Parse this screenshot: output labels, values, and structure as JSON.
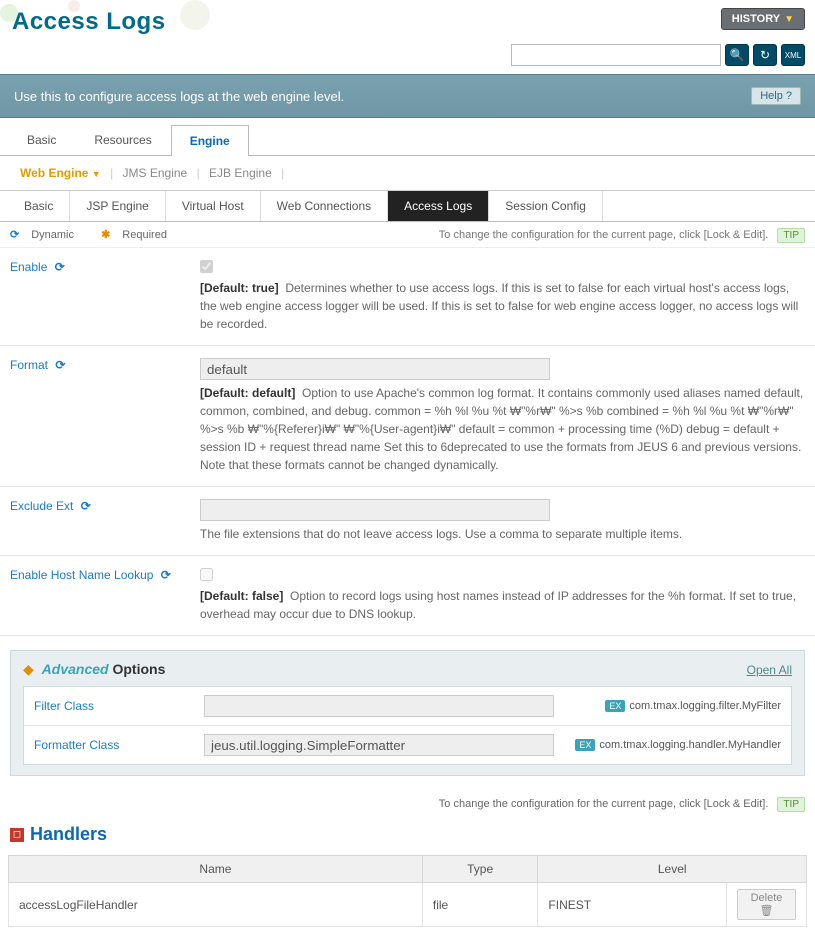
{
  "header": {
    "title": "Access Logs",
    "history_label": "HISTORY"
  },
  "search": {
    "placeholder": ""
  },
  "banner": {
    "text": "Use this to configure access logs at the web engine level.",
    "help_label": "Help ?"
  },
  "tabs1": {
    "basic": "Basic",
    "resources": "Resources",
    "engine": "Engine"
  },
  "subnav": {
    "web": "Web Engine",
    "jms": "JMS Engine",
    "ejb": "EJB Engine"
  },
  "tabs2": {
    "basic": "Basic",
    "jsp": "JSP Engine",
    "vhost": "Virtual Host",
    "webconn": "Web Connections",
    "accesslogs": "Access Logs",
    "session": "Session Config"
  },
  "meta": {
    "dynamic": "Dynamic",
    "required": "Required",
    "tip": "To change the configuration for the current page, click [Lock & Edit].",
    "tip_badge": "TIP"
  },
  "fields": {
    "enable": {
      "label": "Enable",
      "default": "[Default: true]",
      "desc": "Determines whether to use access logs. If this is set to false for each virtual host's access logs, the web engine access logger will be used. If this is set to false for web engine access logger, no access logs will be recorded."
    },
    "format": {
      "label": "Format",
      "value": "default",
      "default": "[Default: default]",
      "desc": "Option to use Apache's common log format. It contains commonly used aliases named default, common, combined, and debug. common = %h %l %u %t ₩\"%r₩\" %>s %b combined = %h %l %u %t ₩\"%r₩\" %>s %b ₩\"%{Referer}i₩\" ₩\"%{User-agent}i₩\" default = common + processing time (%D) debug = default + session ID + request thread name Set this to 6deprecated to use the formats from JEUS 6 and previous versions. Note that these formats cannot be changed dynamically."
    },
    "exclude": {
      "label": "Exclude Ext",
      "value": "",
      "desc": "The file extensions that do not leave access logs. Use a comma to separate multiple items."
    },
    "hostlookup": {
      "label": "Enable Host Name Lookup",
      "default": "[Default: false]",
      "desc": "Option to record logs using host names instead of IP addresses for the %h format. If set to true, overhead may occur due to DNS lookup."
    }
  },
  "advanced": {
    "title_em": "Advanced",
    "title_rest": "Options",
    "open_all": "Open All",
    "filter": {
      "label": "Filter Class",
      "value": "",
      "ex": "com.tmax.logging.filter.MyFilter"
    },
    "formatter": {
      "label": "Formatter Class",
      "value": "jeus.util.logging.SimpleFormatter",
      "ex": "com.tmax.logging.handler.MyHandler"
    },
    "ex_badge": "EX"
  },
  "handlers": {
    "title": "Handlers",
    "cols": {
      "name": "Name",
      "type": "Type",
      "level": "Level"
    },
    "row": {
      "name": "accessLogFileHandler",
      "type": "file",
      "level": "FINEST",
      "delete": "Delete"
    }
  }
}
